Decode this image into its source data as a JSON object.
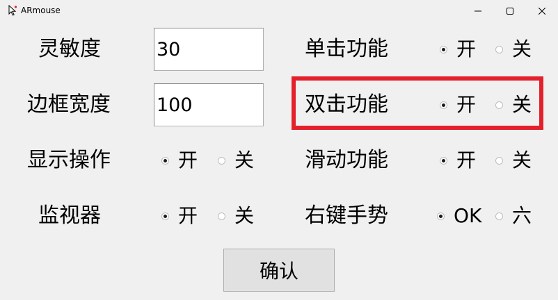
{
  "window": {
    "title": "ARmouse",
    "app_icon": "cursor-icon",
    "controls": {
      "minimize_icon": "minimize-icon",
      "maximize_icon": "maximize-icon",
      "close_icon": "close-icon"
    }
  },
  "left": {
    "sensitivity": {
      "label": "灵敏度",
      "value": "30"
    },
    "border_width": {
      "label": "边框宽度",
      "value": "100"
    },
    "show_operation": {
      "label": "显示操作",
      "options": [
        {
          "label": "开",
          "checked": true
        },
        {
          "label": "关",
          "checked": false
        }
      ]
    },
    "monitor": {
      "label": "监视器",
      "options": [
        {
          "label": "开",
          "checked": true
        },
        {
          "label": "关",
          "checked": false
        }
      ]
    }
  },
  "right": {
    "single_click": {
      "label": "单击功能",
      "options": [
        {
          "label": "开",
          "checked": true
        },
        {
          "label": "关",
          "checked": false
        }
      ]
    },
    "double_click": {
      "label": "双击功能",
      "options": [
        {
          "label": "开",
          "checked": true
        },
        {
          "label": "关",
          "checked": false
        }
      ]
    },
    "slide": {
      "label": "滑动功能",
      "options": [
        {
          "label": "开",
          "checked": true
        },
        {
          "label": "关",
          "checked": false
        }
      ]
    },
    "right_gesture": {
      "label": "右键手势",
      "options": [
        {
          "label": "OK",
          "checked": true
        },
        {
          "label": "六",
          "checked": false
        }
      ]
    }
  },
  "highlight_color": "#e3202b",
  "confirm_button": {
    "label": "确认"
  }
}
